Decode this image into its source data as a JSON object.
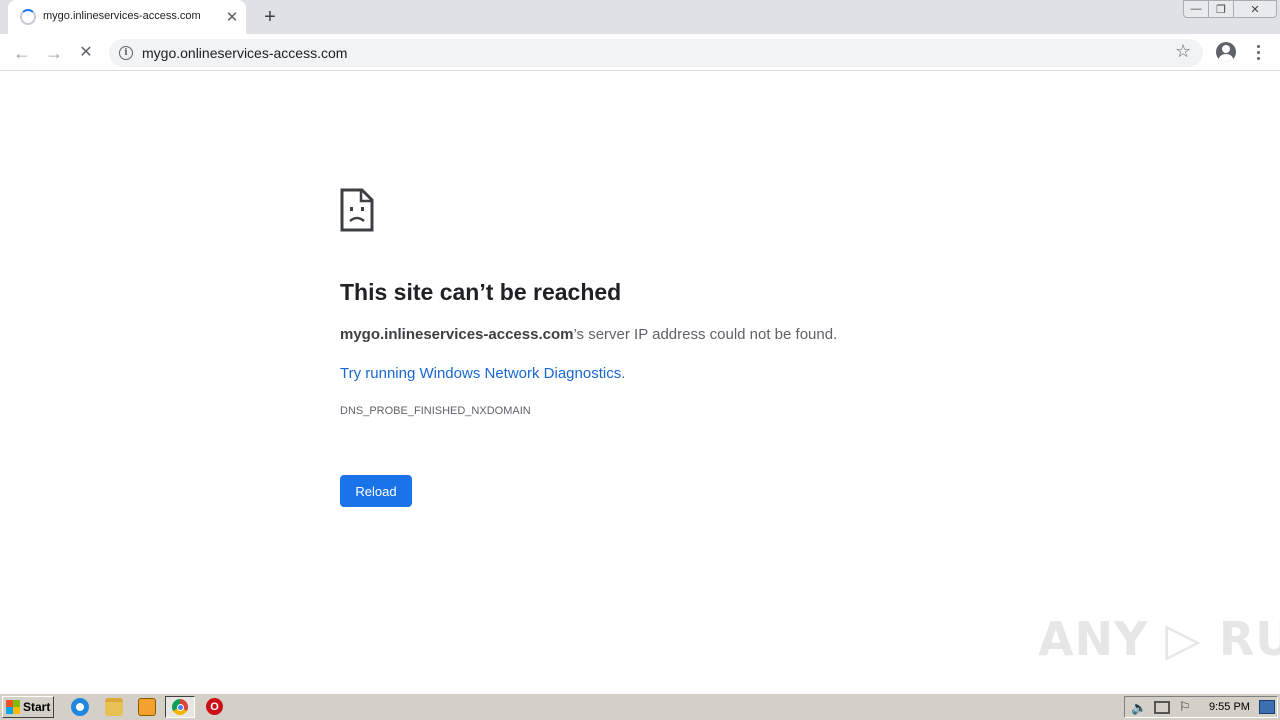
{
  "browser": {
    "tab": {
      "title": "mygo.inlineservices-access.com",
      "close_glyph": "✕",
      "loading": true
    },
    "new_tab_glyph": "+",
    "window_controls": {
      "minimize_glyph": "—",
      "restore_glyph": "❐",
      "close_glyph": "✕"
    },
    "toolbar": {
      "back_glyph": "←",
      "forward_glyph": "→",
      "stop_glyph": "✕",
      "url": "mygo.onlineservices-access.com",
      "info_glyph": "i",
      "bookmark_glyph": "☆"
    }
  },
  "error_page": {
    "icon": "sad-page-icon",
    "title": "This site can’t be reached",
    "host": "mygo.inlineservices-access.com",
    "description_suffix": "’s server IP address could not be found.",
    "diagnostics_link": "Try running Windows Network Diagnostics",
    "diagnostics_suffix": ".",
    "error_code": "DNS_PROBE_FINISHED_NXDOMAIN",
    "reload_label": "Reload"
  },
  "watermark": "ANY ▷ RUN",
  "taskbar": {
    "start_label": "Start",
    "opera_glyph": "O",
    "clock": "9:55 PM",
    "volume_glyph": "🔈",
    "flag_glyph": "⚐"
  },
  "colors": {
    "accent": "#1a73e8",
    "link": "#1967d2",
    "title_text": "#202124",
    "body_text": "#5f6368",
    "tab_strip": "#dee1e6",
    "taskbar": "#d4d0c8"
  }
}
